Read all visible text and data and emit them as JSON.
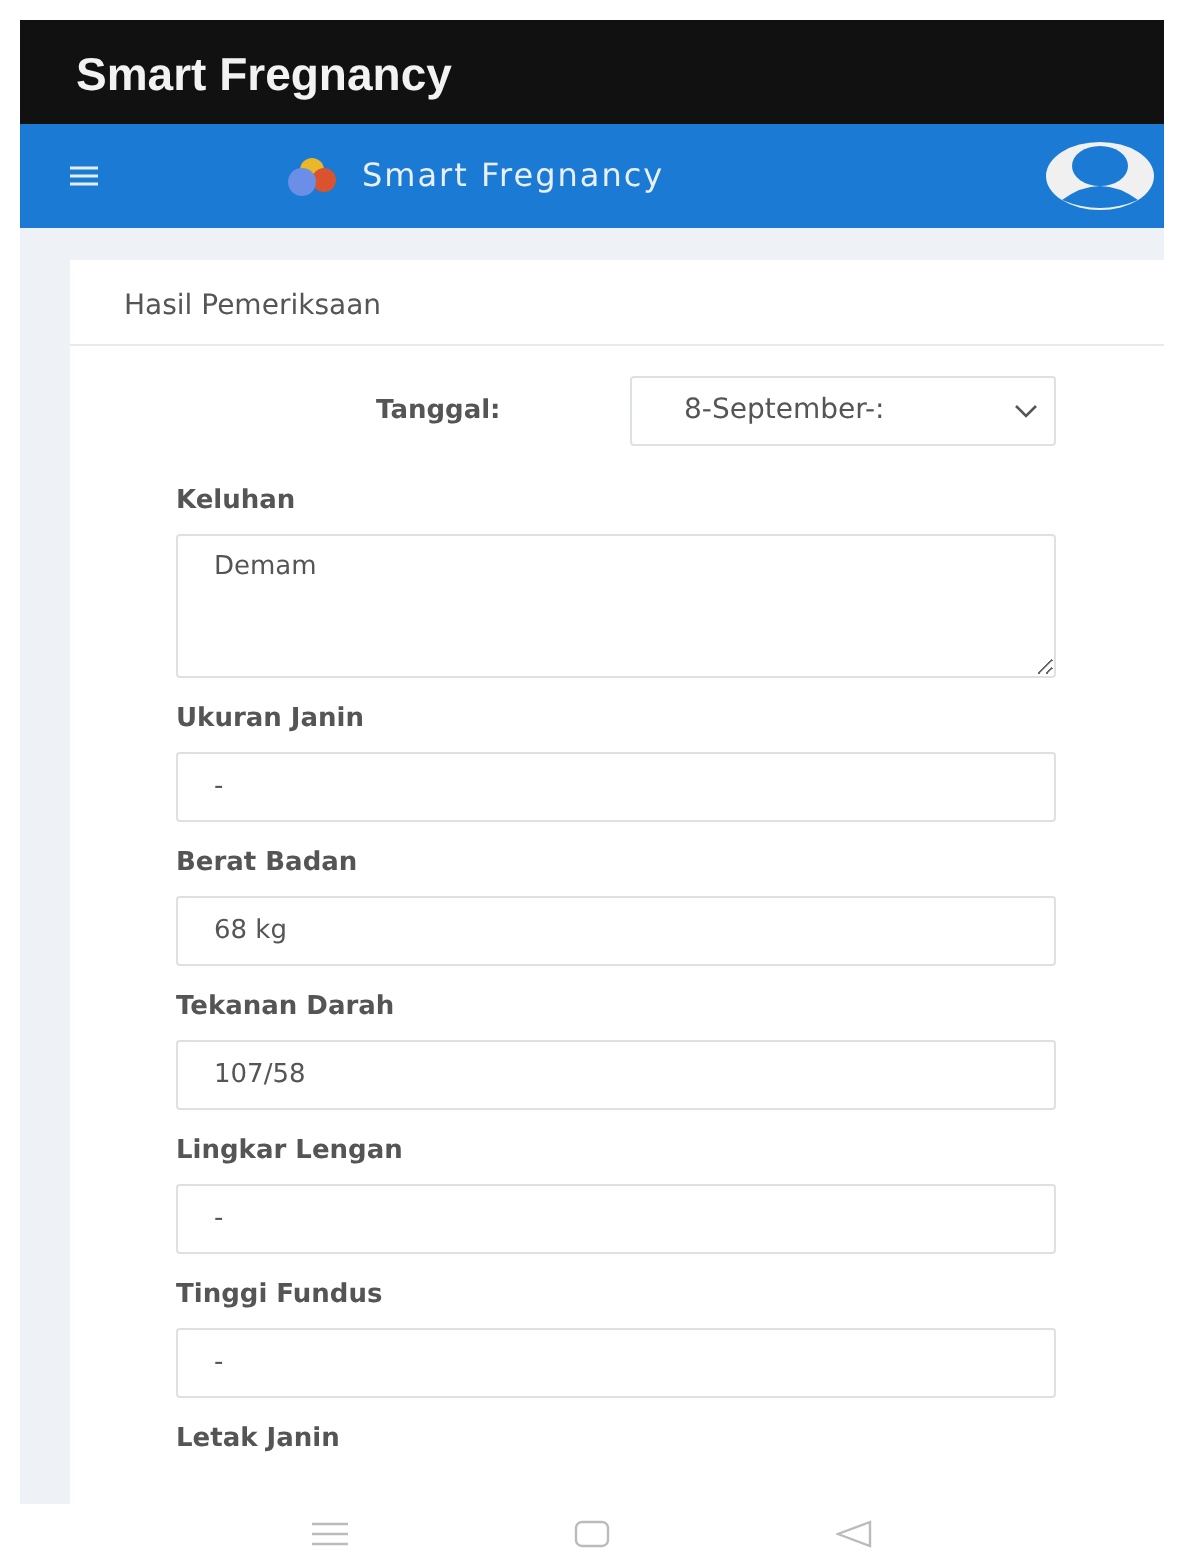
{
  "app_title": "Smart Fregnancy",
  "navbar": {
    "brand": "Smart Fregnancy"
  },
  "card": {
    "header": "Hasil Pemeriksaan",
    "date": {
      "label": "Tanggal:",
      "value": "8-September-:"
    },
    "fields": [
      {
        "kind": "textarea",
        "label": "Keluhan",
        "value": "Demam"
      },
      {
        "kind": "input",
        "label": "Ukuran Janin",
        "value": "-"
      },
      {
        "kind": "input",
        "label": "Berat Badan",
        "value": "68 kg"
      },
      {
        "kind": "input",
        "label": "Tekanan Darah",
        "value": "107/58"
      },
      {
        "kind": "input",
        "label": "Lingkar Lengan",
        "value": "-"
      },
      {
        "kind": "input",
        "label": "Tinggi Fundus",
        "value": "-"
      },
      {
        "kind": "label",
        "label": "Letak Janin"
      }
    ]
  }
}
